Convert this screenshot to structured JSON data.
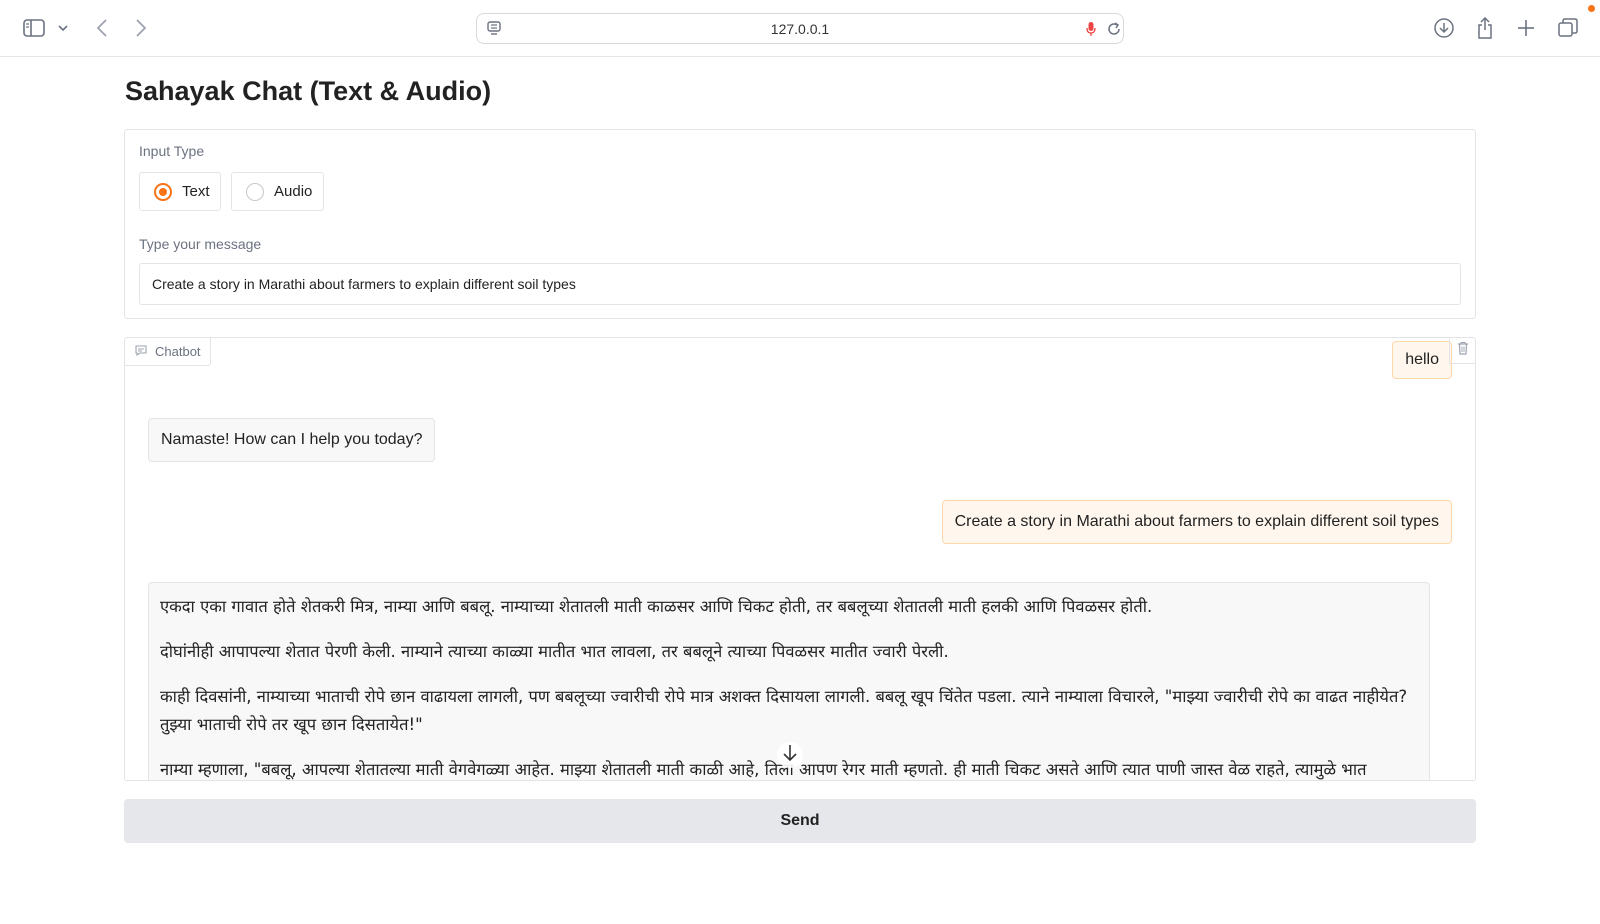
{
  "browser": {
    "url": "127.0.0.1"
  },
  "page": {
    "title": "Sahayak Chat (Text & Audio)"
  },
  "input_panel": {
    "input_type_label": "Input Type",
    "options": [
      {
        "label": "Text",
        "selected": true
      },
      {
        "label": "Audio",
        "selected": false
      }
    ],
    "message_label": "Type your message",
    "message_value": "Create a story in Marathi about farmers to explain different soil types"
  },
  "chatbot": {
    "label": "Chatbot",
    "messages": [
      {
        "role": "user",
        "text": "hello"
      },
      {
        "role": "bot",
        "text": "Namaste! How can I help you today?"
      },
      {
        "role": "user",
        "text": "Create a story in Marathi about farmers to explain different soil types"
      },
      {
        "role": "bot",
        "paragraphs": [
          "एकदा एका गावात होते शेतकरी मित्र, नाम्या आणि बबलू. नाम्याच्या शेतातली माती काळसर आणि चिकट होती, तर बबलूच्या शेतातली माती हलकी आणि पिवळसर होती.",
          "दोघांनीही आपापल्या शेतात पेरणी केली. नाम्याने त्याच्या काळ्या मातीत भात लावला, तर बबलूने त्याच्या पिवळसर मातीत ज्वारी पेरली.",
          "काही दिवसांनी, नाम्याच्या भाताची रोपे छान वाढायला लागली, पण बबलूच्या ज्वारीची रोपे मात्र अशक्त दिसायला लागली. बबलू खूप चिंतेत पडला. त्याने नाम्याला विचारले, \"माझ्या ज्वारीची रोपे का वाढत नाहीयेत? तुझ्या भाताची रोपे तर खूप छान दिसतायेत!\"",
          "नाम्या म्हणाला, \"बबलू, आपल्या शेतातल्या माती वेगवेगळ्या आहेत. माझ्या शेतातली माती काळी आहे, तिला आपण रेगर माती म्हणतो. ही माती चिकट असते आणि त्यात पाणी जास्त वेळ राहते, त्यामुळे भात"
        ]
      }
    ]
  },
  "send_button": {
    "label": "Send"
  },
  "colors": {
    "accent": "#f97316",
    "user_bubble_bg": "#fff7ed",
    "bot_bubble_bg": "#f8f8f9",
    "send_bg": "#e5e7eb"
  }
}
